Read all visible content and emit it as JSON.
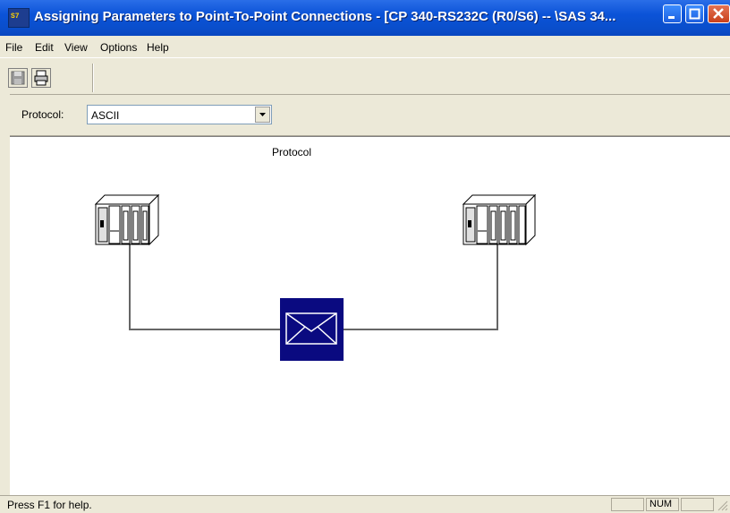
{
  "window": {
    "title": "Assigning Parameters to Point-To-Point Connections - [CP 340-RS232C  (R0/S6)  -- \\SAS 34..."
  },
  "menu": {
    "file": "File",
    "edit": "Edit",
    "view": "View",
    "options": "Options",
    "help": "Help"
  },
  "protocol_bar": {
    "label": "Protocol:",
    "selected": "ASCII"
  },
  "diagram": {
    "protocol_label": "Protocol"
  },
  "status": {
    "help_text": "Press F1 for help.",
    "num": "NUM"
  }
}
